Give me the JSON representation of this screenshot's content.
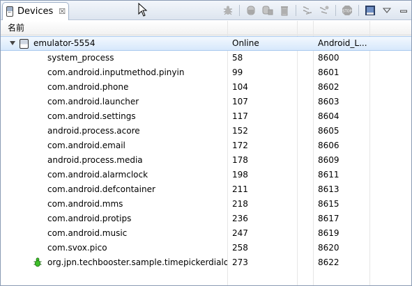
{
  "tab": {
    "label": "Devices",
    "close": "☒"
  },
  "toolbar": {
    "icons": [
      "debug-icon",
      "update-heap-icon",
      "dump-hprof-icon",
      "cause-gc-icon",
      "update-threads-icon",
      "start-method-profiling-icon",
      "stop-process-icon",
      "screen-capture-icon",
      "view-menu-icon",
      "minimize-icon",
      "maximize-icon"
    ]
  },
  "columns": {
    "name": "名前",
    "pid": "",
    "port": ""
  },
  "device": {
    "name": "emulator-5554",
    "status": "Online",
    "target": "Android_L..."
  },
  "processes": [
    {
      "name": "system_process",
      "pid": "58",
      "port": "8600"
    },
    {
      "name": "com.android.inputmethod.pinyin",
      "pid": "99",
      "port": "8601"
    },
    {
      "name": "com.android.phone",
      "pid": "104",
      "port": "8602"
    },
    {
      "name": "com.android.launcher",
      "pid": "107",
      "port": "8603"
    },
    {
      "name": "com.android.settings",
      "pid": "117",
      "port": "8604"
    },
    {
      "name": "android.process.acore",
      "pid": "152",
      "port": "8605"
    },
    {
      "name": "com.android.email",
      "pid": "172",
      "port": "8606"
    },
    {
      "name": "android.process.media",
      "pid": "178",
      "port": "8609"
    },
    {
      "name": "com.android.alarmclock",
      "pid": "198",
      "port": "8611"
    },
    {
      "name": "com.android.defcontainer",
      "pid": "211",
      "port": "8613"
    },
    {
      "name": "com.android.mms",
      "pid": "218",
      "port": "8615"
    },
    {
      "name": "com.android.protips",
      "pid": "236",
      "port": "8617"
    },
    {
      "name": "com.android.music",
      "pid": "247",
      "port": "8619"
    },
    {
      "name": "com.svox.pico",
      "pid": "258",
      "port": "8620"
    },
    {
      "name": "org.jpn.techbooster.sample.timepickerdialog",
      "pid": "273",
      "port": "8622",
      "debug": true
    }
  ]
}
